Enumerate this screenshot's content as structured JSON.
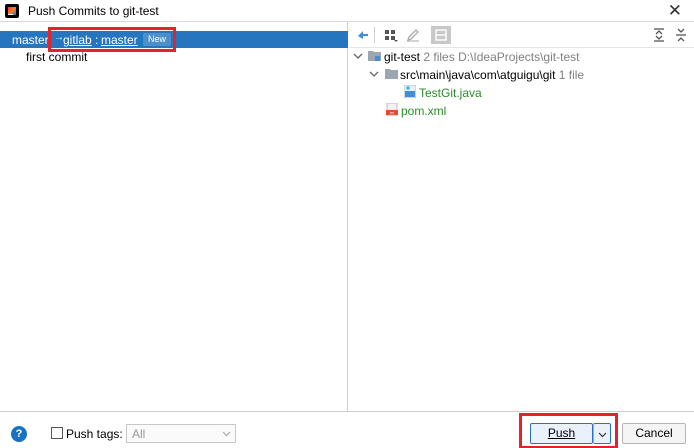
{
  "window": {
    "title": "Push Commits to git-test",
    "close_glyph": "✕"
  },
  "left": {
    "branch": "master",
    "arrow": "→",
    "remote": "gitlab",
    "colon": ":",
    "remote_branch": "master",
    "badge": "New",
    "commits": [
      "first commit"
    ]
  },
  "right": {
    "toolbar_icons": [
      "pin-icon",
      "group-by-icon",
      "edit-icon",
      "diff-icon",
      "expand-all-icon",
      "collapse-all-icon"
    ],
    "tree": {
      "root": {
        "name": "git-test",
        "count": "2 files",
        "path": "D:\\IdeaProjects\\git-test"
      },
      "folder": {
        "name": "src\\main\\java\\com\\atguigu\\git",
        "count": "1 file"
      },
      "file_java": "TestGit.java",
      "file_xml": "pom.xml"
    }
  },
  "bottom": {
    "help": "?",
    "push_tags_label": "Push tags:",
    "tags_value": "All",
    "push_label": "Push",
    "cancel_label": "Cancel"
  },
  "colors": {
    "selection": "#2675bf",
    "highlight": "#e8202a",
    "added_file": "#2a8c2a"
  }
}
